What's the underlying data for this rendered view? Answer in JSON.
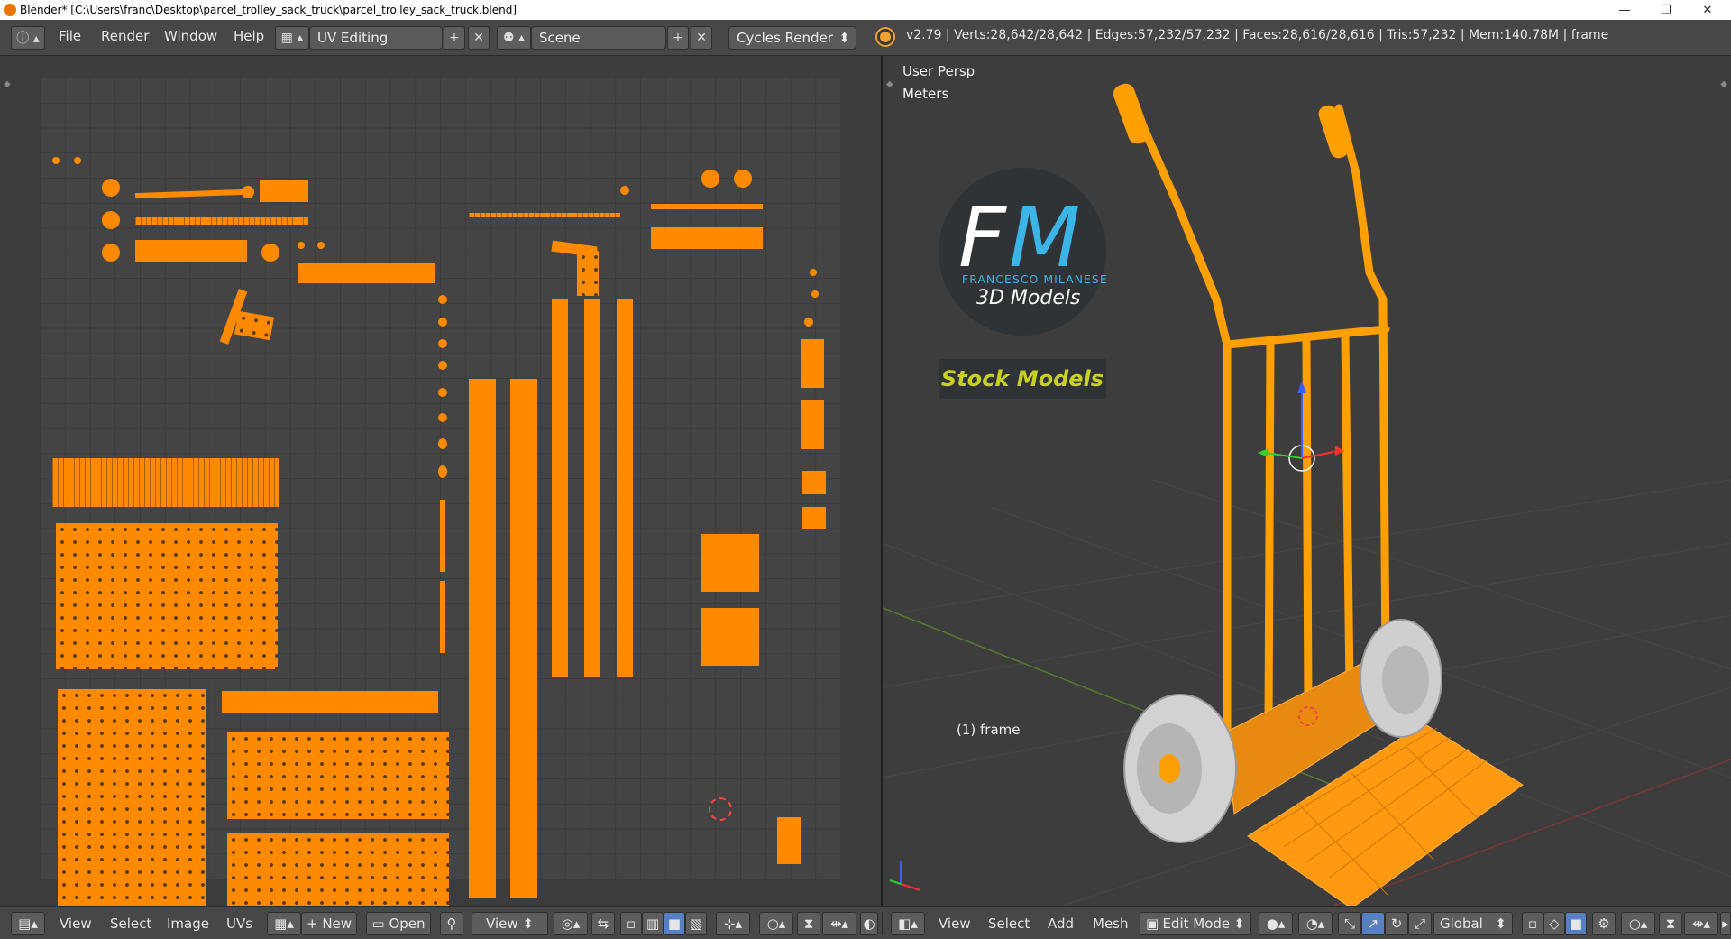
{
  "window": {
    "title": "Blender* [C:\\Users\\franc\\Desktop\\parcel_trolley_sack_truck\\parcel_trolley_sack_truck.blend]",
    "minimize": "—",
    "maximize": "❐",
    "close": "✕"
  },
  "topbar": {
    "menus": [
      "File",
      "Render",
      "Window",
      "Help"
    ],
    "layout_value": "UV Editing",
    "scene_value": "Scene",
    "render_engine": "Cycles Render",
    "stats": "v2.79 | Verts:28,642/28,642 | Edges:57,232/57,232 | Faces:28,616/28,616 | Tris:57,232 | Mem:140.78M | frame"
  },
  "uv_editor": {
    "menus": [
      "View",
      "Select",
      "Image",
      "UVs"
    ],
    "new_label": "New",
    "open_label": "Open",
    "view_label": "View"
  },
  "viewport": {
    "view_name": "User Persp",
    "units": "Meters",
    "object_label": "(1) frame",
    "menus": [
      "View",
      "Select",
      "Add",
      "Mesh"
    ],
    "mode": "Edit Mode",
    "orientation": "Global",
    "watermark": {
      "initials_f": "F",
      "initials_m": "M",
      "author": "FRANCESCO MILANESE",
      "subtitle": "3D Models",
      "banner": "Stock Models"
    }
  },
  "colors": {
    "accent_orange": "#ff8a00",
    "ui_bg": "#474747",
    "viewport_bg": "#3d3d3d",
    "select_blue": "#5680c2"
  }
}
